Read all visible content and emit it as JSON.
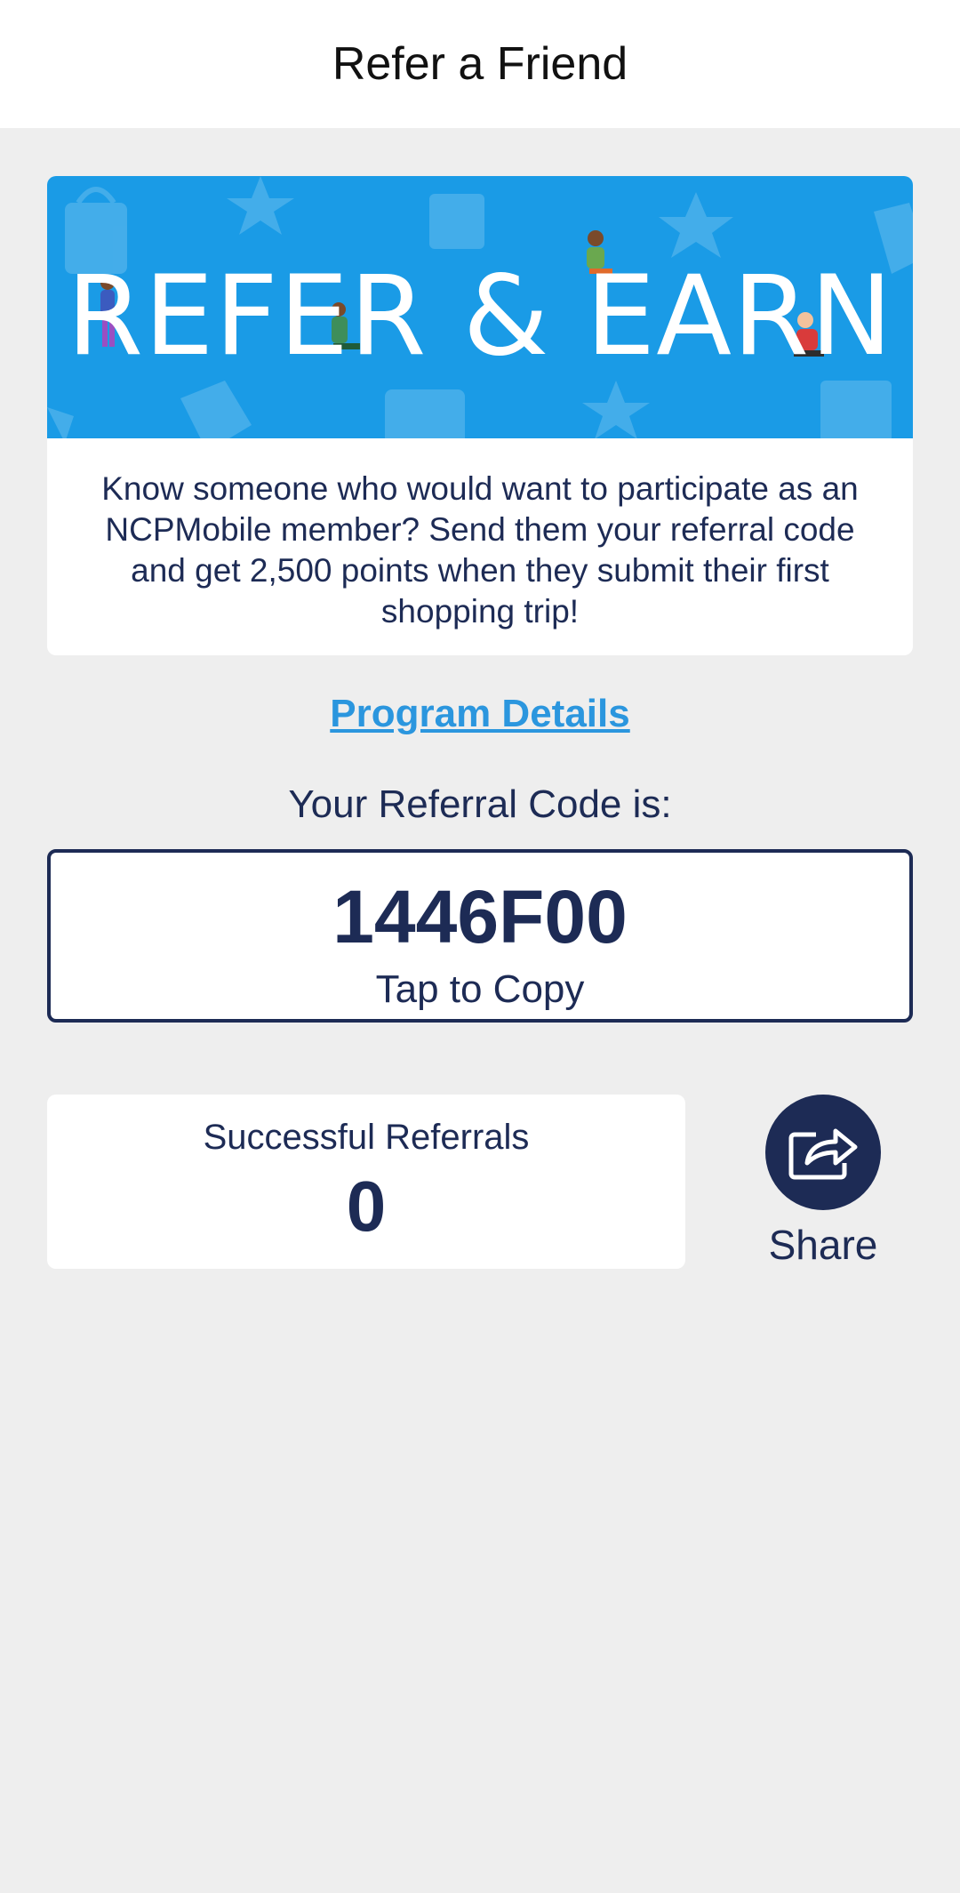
{
  "header": {
    "title": "Refer a Friend"
  },
  "banner": {
    "text": "REFER & EARN"
  },
  "promo": {
    "description": "Know someone who would want to participate as an NCPMobile member? Send them your referral code and get 2,500 points when they submit their first shopping trip!"
  },
  "program_details": {
    "label": "Program Details"
  },
  "referral": {
    "label": "Your Referral Code is:",
    "code": "1446F00",
    "hint": "Tap to Copy"
  },
  "stats": {
    "successful_label": "Successful Referrals",
    "successful_count": "0"
  },
  "share": {
    "label": "Share",
    "icon": "share-arrow-icon"
  },
  "colors": {
    "navy": "#1d2b55",
    "banner_blue": "#1a9be6",
    "link_blue": "#2b96de",
    "background": "#eeeeee"
  }
}
